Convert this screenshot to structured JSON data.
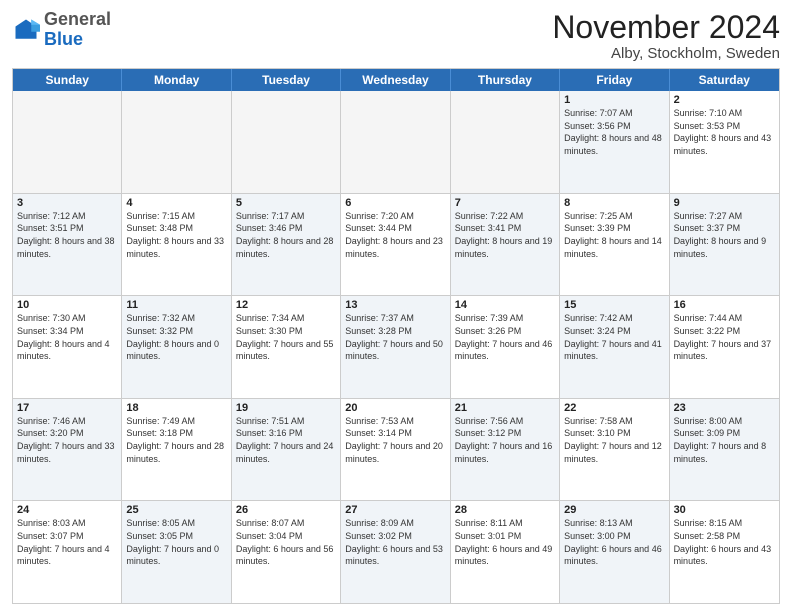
{
  "header": {
    "logo_general": "General",
    "logo_blue": "Blue",
    "month_title": "November 2024",
    "location": "Alby, Stockholm, Sweden"
  },
  "calendar": {
    "days_of_week": [
      "Sunday",
      "Monday",
      "Tuesday",
      "Wednesday",
      "Thursday",
      "Friday",
      "Saturday"
    ],
    "weeks": [
      [
        {
          "day": "",
          "info": "",
          "empty": true
        },
        {
          "day": "",
          "info": "",
          "empty": true
        },
        {
          "day": "",
          "info": "",
          "empty": true
        },
        {
          "day": "",
          "info": "",
          "empty": true
        },
        {
          "day": "",
          "info": "",
          "empty": true
        },
        {
          "day": "1",
          "info": "Sunrise: 7:07 AM\nSunset: 3:56 PM\nDaylight: 8 hours and 48 minutes.",
          "empty": false,
          "shaded": true
        },
        {
          "day": "2",
          "info": "Sunrise: 7:10 AM\nSunset: 3:53 PM\nDaylight: 8 hours and 43 minutes.",
          "empty": false,
          "shaded": false
        }
      ],
      [
        {
          "day": "3",
          "info": "Sunrise: 7:12 AM\nSunset: 3:51 PM\nDaylight: 8 hours and 38 minutes.",
          "empty": false,
          "shaded": true
        },
        {
          "day": "4",
          "info": "Sunrise: 7:15 AM\nSunset: 3:48 PM\nDaylight: 8 hours and 33 minutes.",
          "empty": false,
          "shaded": false
        },
        {
          "day": "5",
          "info": "Sunrise: 7:17 AM\nSunset: 3:46 PM\nDaylight: 8 hours and 28 minutes.",
          "empty": false,
          "shaded": true
        },
        {
          "day": "6",
          "info": "Sunrise: 7:20 AM\nSunset: 3:44 PM\nDaylight: 8 hours and 23 minutes.",
          "empty": false,
          "shaded": false
        },
        {
          "day": "7",
          "info": "Sunrise: 7:22 AM\nSunset: 3:41 PM\nDaylight: 8 hours and 19 minutes.",
          "empty": false,
          "shaded": true
        },
        {
          "day": "8",
          "info": "Sunrise: 7:25 AM\nSunset: 3:39 PM\nDaylight: 8 hours and 14 minutes.",
          "empty": false,
          "shaded": false
        },
        {
          "day": "9",
          "info": "Sunrise: 7:27 AM\nSunset: 3:37 PM\nDaylight: 8 hours and 9 minutes.",
          "empty": false,
          "shaded": true
        }
      ],
      [
        {
          "day": "10",
          "info": "Sunrise: 7:30 AM\nSunset: 3:34 PM\nDaylight: 8 hours and 4 minutes.",
          "empty": false,
          "shaded": false
        },
        {
          "day": "11",
          "info": "Sunrise: 7:32 AM\nSunset: 3:32 PM\nDaylight: 8 hours and 0 minutes.",
          "empty": false,
          "shaded": true
        },
        {
          "day": "12",
          "info": "Sunrise: 7:34 AM\nSunset: 3:30 PM\nDaylight: 7 hours and 55 minutes.",
          "empty": false,
          "shaded": false
        },
        {
          "day": "13",
          "info": "Sunrise: 7:37 AM\nSunset: 3:28 PM\nDaylight: 7 hours and 50 minutes.",
          "empty": false,
          "shaded": true
        },
        {
          "day": "14",
          "info": "Sunrise: 7:39 AM\nSunset: 3:26 PM\nDaylight: 7 hours and 46 minutes.",
          "empty": false,
          "shaded": false
        },
        {
          "day": "15",
          "info": "Sunrise: 7:42 AM\nSunset: 3:24 PM\nDaylight: 7 hours and 41 minutes.",
          "empty": false,
          "shaded": true
        },
        {
          "day": "16",
          "info": "Sunrise: 7:44 AM\nSunset: 3:22 PM\nDaylight: 7 hours and 37 minutes.",
          "empty": false,
          "shaded": false
        }
      ],
      [
        {
          "day": "17",
          "info": "Sunrise: 7:46 AM\nSunset: 3:20 PM\nDaylight: 7 hours and 33 minutes.",
          "empty": false,
          "shaded": true
        },
        {
          "day": "18",
          "info": "Sunrise: 7:49 AM\nSunset: 3:18 PM\nDaylight: 7 hours and 28 minutes.",
          "empty": false,
          "shaded": false
        },
        {
          "day": "19",
          "info": "Sunrise: 7:51 AM\nSunset: 3:16 PM\nDaylight: 7 hours and 24 minutes.",
          "empty": false,
          "shaded": true
        },
        {
          "day": "20",
          "info": "Sunrise: 7:53 AM\nSunset: 3:14 PM\nDaylight: 7 hours and 20 minutes.",
          "empty": false,
          "shaded": false
        },
        {
          "day": "21",
          "info": "Sunrise: 7:56 AM\nSunset: 3:12 PM\nDaylight: 7 hours and 16 minutes.",
          "empty": false,
          "shaded": true
        },
        {
          "day": "22",
          "info": "Sunrise: 7:58 AM\nSunset: 3:10 PM\nDaylight: 7 hours and 12 minutes.",
          "empty": false,
          "shaded": false
        },
        {
          "day": "23",
          "info": "Sunrise: 8:00 AM\nSunset: 3:09 PM\nDaylight: 7 hours and 8 minutes.",
          "empty": false,
          "shaded": true
        }
      ],
      [
        {
          "day": "24",
          "info": "Sunrise: 8:03 AM\nSunset: 3:07 PM\nDaylight: 7 hours and 4 minutes.",
          "empty": false,
          "shaded": false
        },
        {
          "day": "25",
          "info": "Sunrise: 8:05 AM\nSunset: 3:05 PM\nDaylight: 7 hours and 0 minutes.",
          "empty": false,
          "shaded": true
        },
        {
          "day": "26",
          "info": "Sunrise: 8:07 AM\nSunset: 3:04 PM\nDaylight: 6 hours and 56 minutes.",
          "empty": false,
          "shaded": false
        },
        {
          "day": "27",
          "info": "Sunrise: 8:09 AM\nSunset: 3:02 PM\nDaylight: 6 hours and 53 minutes.",
          "empty": false,
          "shaded": true
        },
        {
          "day": "28",
          "info": "Sunrise: 8:11 AM\nSunset: 3:01 PM\nDaylight: 6 hours and 49 minutes.",
          "empty": false,
          "shaded": false
        },
        {
          "day": "29",
          "info": "Sunrise: 8:13 AM\nSunset: 3:00 PM\nDaylight: 6 hours and 46 minutes.",
          "empty": false,
          "shaded": true
        },
        {
          "day": "30",
          "info": "Sunrise: 8:15 AM\nSunset: 2:58 PM\nDaylight: 6 hours and 43 minutes.",
          "empty": false,
          "shaded": false
        }
      ]
    ]
  }
}
